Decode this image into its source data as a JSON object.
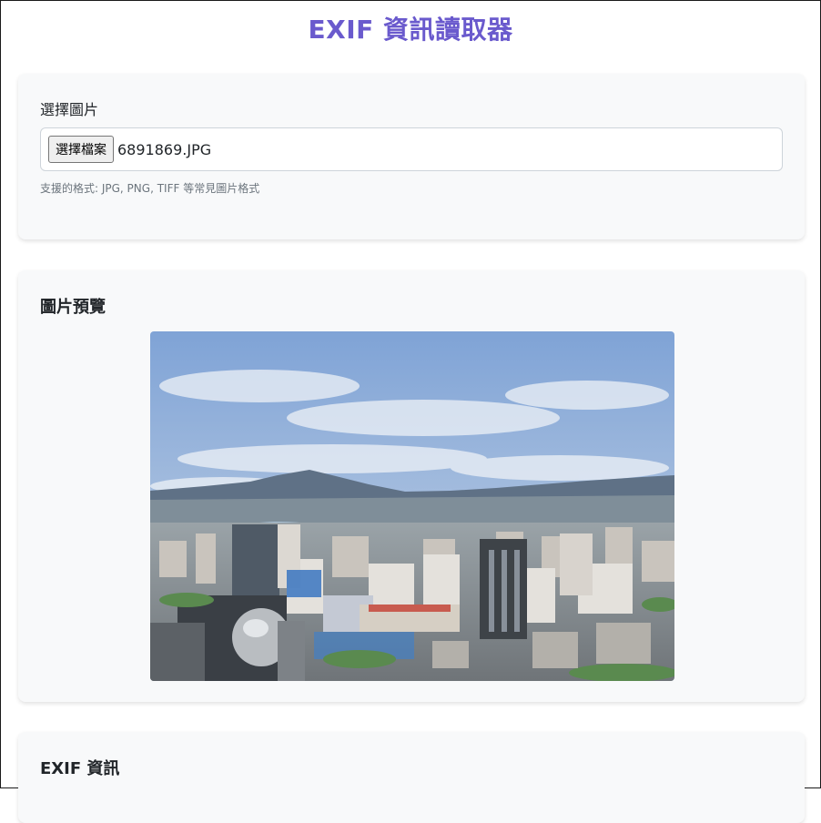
{
  "page": {
    "title": "EXIF 資訊讀取器"
  },
  "upload": {
    "label": "選擇圖片",
    "button_label": "選擇檔案",
    "file_name": "6891869.JPG",
    "help_text": "支援的格式: JPG, PNG, TIFF 等常見圖片格式"
  },
  "preview": {
    "title": "圖片預覽",
    "image_subject": "city-skyline-photo"
  },
  "exif": {
    "title": "EXIF 資訊"
  },
  "colors": {
    "accent": "#6a5acd",
    "card_background": "#f8f9fa",
    "muted_text": "#6c757d"
  }
}
